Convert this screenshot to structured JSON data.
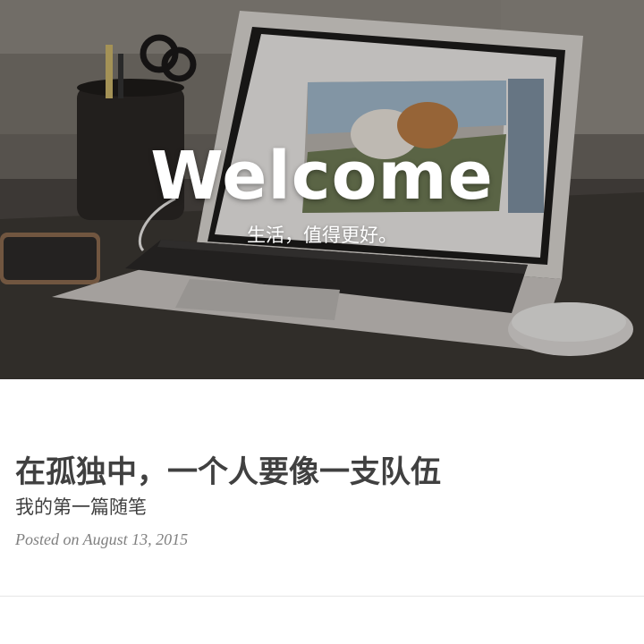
{
  "hero": {
    "title": "Welcome",
    "subtitle": "生活，值得更好。"
  },
  "post": {
    "title": "在孤独中，一个人要像一支队伍",
    "subtitle": "我的第一篇随笔",
    "meta": "Posted on August 13, 2015"
  },
  "colors": {
    "heading": "#404040",
    "meta": "#808080",
    "divider": "#e6e6e6"
  }
}
